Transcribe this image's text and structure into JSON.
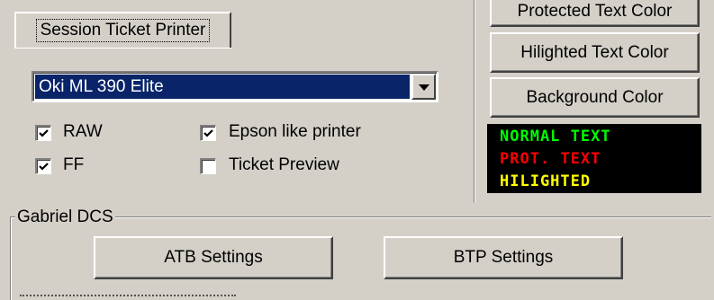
{
  "tabs": {
    "session_ticket_printer": "Session Ticket Printer"
  },
  "printer": {
    "selected": "Oki ML 390 Elite"
  },
  "checkboxes": {
    "raw": {
      "label": "RAW",
      "checked": true
    },
    "ff": {
      "label": "FF",
      "checked": true
    },
    "epson": {
      "label": "Epson like printer",
      "checked": true
    },
    "ticket_preview": {
      "label": "Ticket Preview",
      "checked": false
    }
  },
  "colors_panel": {
    "protected_text_color": "Protected Text Color",
    "hilighted_text_color": "Hilighted Text Color",
    "background_color": "Background Color"
  },
  "preview": {
    "normal": "NORMAL TEXT",
    "prot": "PROT. TEXT",
    "hilighted": "HILIGHTED",
    "normal_color": "#00ff00",
    "prot_color": "#ff0000",
    "hilighted_color": "#ffff00",
    "background": "#000000"
  },
  "gabriel_group": {
    "title": "Gabriel DCS",
    "atb_settings": "ATB Settings",
    "btp_settings": "BTP Settings"
  }
}
